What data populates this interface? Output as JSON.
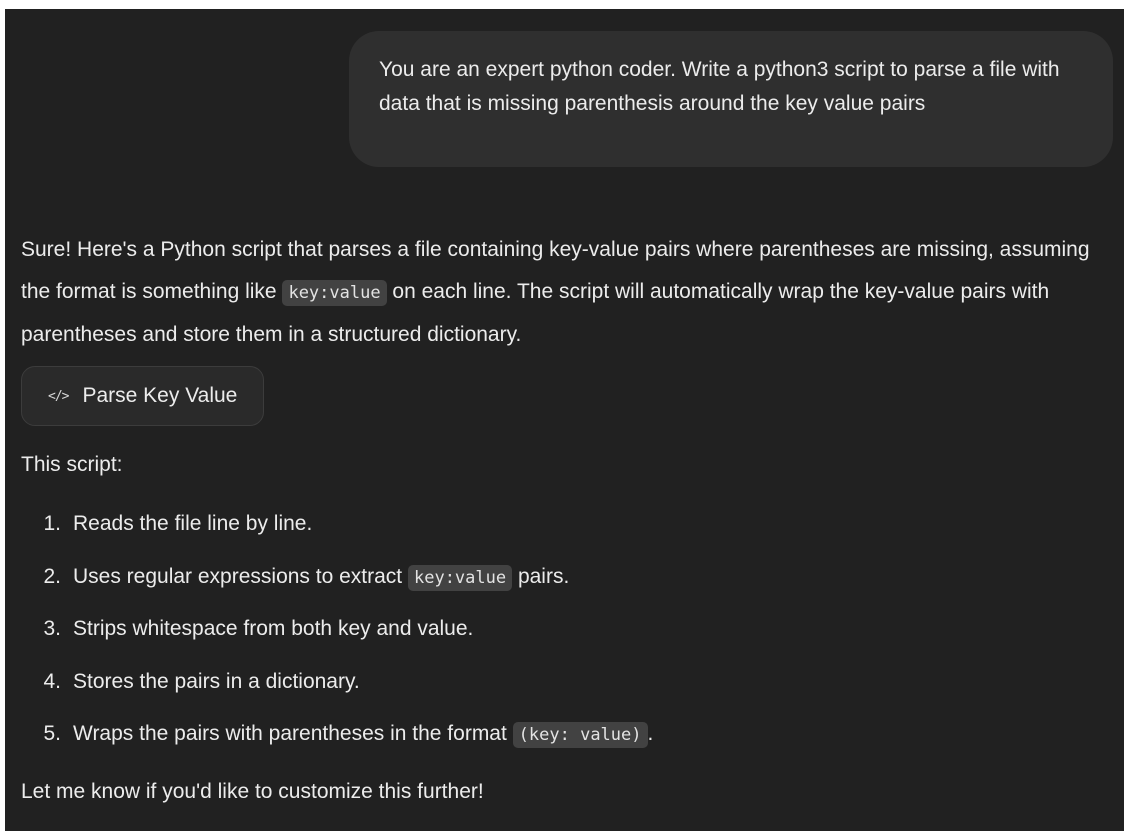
{
  "user_message": {
    "text": "You are an expert python coder. Write a python3 script to parse a file with data that is missing parenthesis around the key value pairs"
  },
  "assistant_message": {
    "intro": {
      "part1": "Sure! Here's a Python script that parses a file containing key-value pairs where parentheses are missing, assuming the format is something like ",
      "code": "key:value",
      "part2": " on each line. The script will automatically wrap the key-value pairs with parentheses and store them in a structured dictionary."
    },
    "artifact": {
      "icon": "code-icon",
      "label": "Parse Key Value"
    },
    "summary_label": "This script:",
    "steps": [
      {
        "number": "1.",
        "text": "Reads the file line by line."
      },
      {
        "number": "2.",
        "before": "Uses regular expressions to extract ",
        "code": "key:value",
        "after": " pairs."
      },
      {
        "number": "3.",
        "text": "Strips whitespace from both key and value."
      },
      {
        "number": "4.",
        "text": "Stores the pairs in a dictionary."
      },
      {
        "number": "5.",
        "before": "Wraps the pairs with parentheses in the format ",
        "code": "(key: value)",
        "after": "."
      }
    ],
    "closing": "Let me know if you'd like to customize this further!"
  },
  "colors": {
    "background": "#212121",
    "user_bubble": "#2f2f2f",
    "text": "#ececec",
    "inline_code_bg": "#424242"
  }
}
